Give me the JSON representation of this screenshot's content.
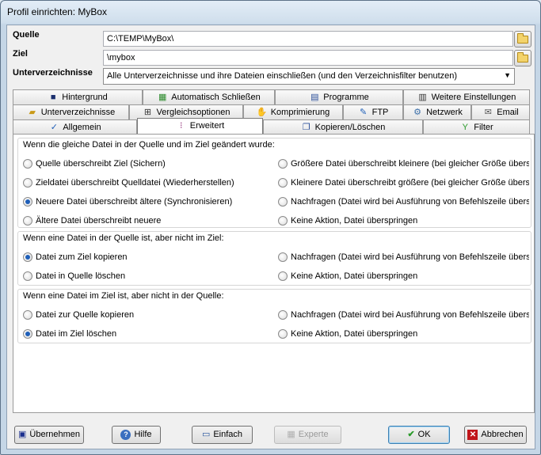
{
  "window": {
    "title": "Profil einrichten: MyBox"
  },
  "source": {
    "label": "Quelle",
    "value": "C:\\TEMP\\MyBox\\"
  },
  "target": {
    "label": "Ziel",
    "value": "\\mybox"
  },
  "subdirs": {
    "label": "Unterverzeichnisse",
    "value": "Alle Unterverzeichnisse und ihre Dateien einschließen  (und den Verzeichnisfilter benutzen)"
  },
  "tabs": {
    "row1": [
      "Hintergrund",
      "Automatisch Schließen",
      "Programme",
      "Weitere Einstellungen"
    ],
    "row2": [
      "Unterverzeichnisse",
      "Vergleichsoptionen",
      "Komprimierung",
      "FTP",
      "Netzwerk",
      "Email"
    ],
    "row3": [
      "Allgemein",
      "Erweitert",
      "Kopieren/Löschen",
      "Filter"
    ],
    "active": "Erweitert"
  },
  "groups": [
    {
      "title": "Wenn die gleiche Datei in der Quelle und im Ziel geändert wurde:",
      "options": [
        {
          "label": "Quelle überschreibt Ziel (Sichern)",
          "selected": false
        },
        {
          "label": "Größere Datei überschreibt kleinere (bei gleicher Größe überspri",
          "selected": false
        },
        {
          "label": "Zieldatei überschreibt Quelldatei (Wiederherstellen)",
          "selected": false
        },
        {
          "label": "Kleinere Datei überschreibt größere (bei gleicher Größe überspri",
          "selected": false
        },
        {
          "label": "Neuere Datei überschreibt ältere (Synchronisieren)",
          "selected": true
        },
        {
          "label": "Nachfragen (Datei wird bei Ausführung von Befehlszeile überspri",
          "selected": false
        },
        {
          "label": "Ältere Datei überschreibt neuere",
          "selected": false
        },
        {
          "label": "Keine Aktion, Datei überspringen",
          "selected": false
        }
      ]
    },
    {
      "title": "Wenn eine Datei in der Quelle ist, aber nicht im Ziel:",
      "options": [
        {
          "label": "Datei zum Ziel kopieren",
          "selected": true
        },
        {
          "label": "Nachfragen (Datei wird bei Ausführung von Befehlszeile überspri",
          "selected": false
        },
        {
          "label": "Datei in Quelle löschen",
          "selected": false
        },
        {
          "label": "Keine Aktion, Datei überspringen",
          "selected": false
        }
      ]
    },
    {
      "title": "Wenn eine Datei im Ziel ist, aber nicht in der Quelle:",
      "options": [
        {
          "label": "Datei zur Quelle kopieren",
          "selected": false
        },
        {
          "label": "Nachfragen (Datei wird bei Ausführung von Befehlszeile überspri",
          "selected": false
        },
        {
          "label": "Datei im Ziel löschen",
          "selected": true
        },
        {
          "label": "Keine Aktion, Datei überspringen",
          "selected": false
        }
      ]
    }
  ],
  "buttons": {
    "apply": "Übernehmen",
    "help": "Hilfe",
    "simple": "Einfach",
    "expert": "Experte",
    "ok": "OK",
    "cancel": "Abbrechen"
  },
  "colors": {
    "accent": "#1f5fb8",
    "ok_check": "#2a9a2a",
    "cancel_x": "#c0161b"
  }
}
